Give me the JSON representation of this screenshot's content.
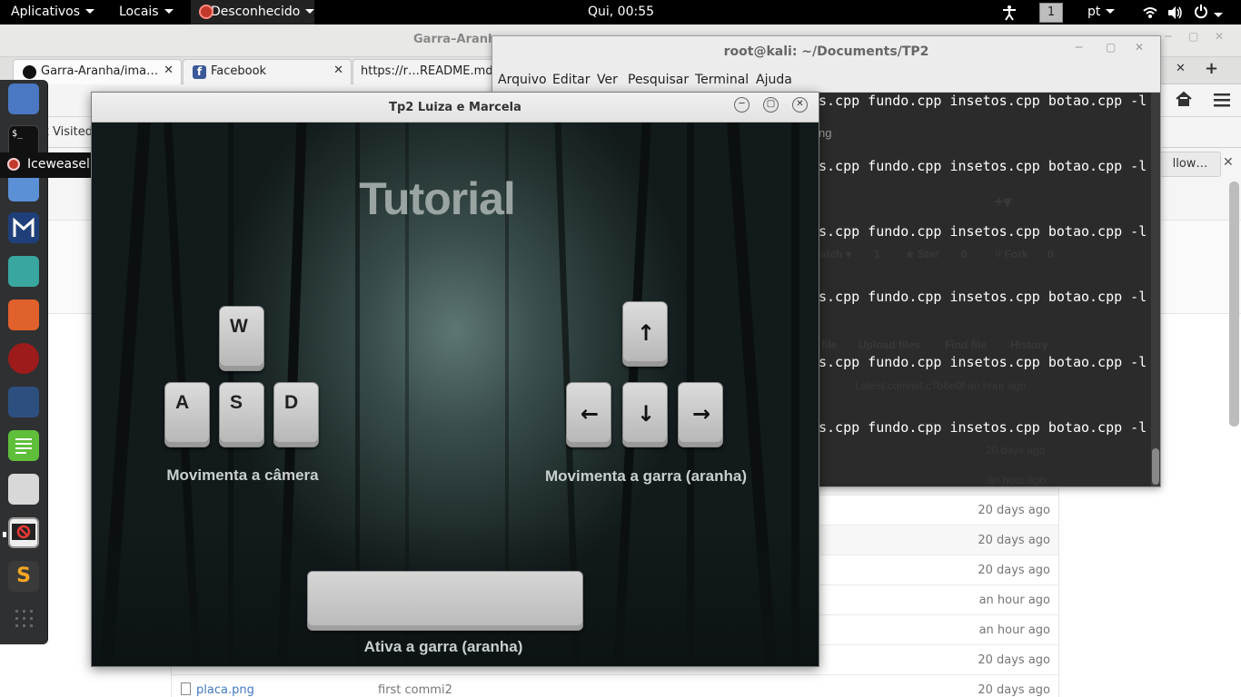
{
  "topbar": {
    "applications": "Aplicativos",
    "places": "Locais",
    "active_app": "Desconhecido",
    "clock": "Qui, 00:55",
    "workspace": "1",
    "language": "pt"
  },
  "browser": {
    "title": "Garra–Aranha",
    "tabs": [
      {
        "label": "Garra-Aranha/ima…"
      },
      {
        "label": "Facebook"
      },
      {
        "label": "https://r…README.md"
      }
    ],
    "bookmarks_text": "st Visited",
    "follow_label": "llow…",
    "repo": {
      "watch_label": "atch",
      "watch_count": "1",
      "star_label": "Star",
      "star_count": "0",
      "fork_label": "Fork",
      "fork_count": "0",
      "tabs_text": [
        "file",
        "Upload files",
        "Find file",
        "History"
      ],
      "latest_commit": "Latest commit c7b6e0f an hour ago"
    },
    "files": [
      {
        "age": "20 days ago"
      },
      {
        "age": "an hour ago"
      },
      {
        "age": "20 days ago"
      },
      {
        "age": "20 days ago"
      },
      {
        "age": "20 days ago"
      },
      {
        "age": "an hour ago"
      },
      {
        "age": "an hour ago"
      },
      {
        "age": "20 days ago"
      },
      {
        "name": "placa.png",
        "message": "first commi2",
        "age": "20 days ago"
      }
    ]
  },
  "terminal": {
    "title": "root@kali: ~/Documents/TP2",
    "menu": [
      "Arquivo",
      "Editar",
      "Ver",
      "Pesquisar",
      "Terminal",
      "Ajuda"
    ],
    "command_fragment": "s.cpp fundo.cpp insetos.cpp botao.cpp -l",
    "faint_fragment": "ng"
  },
  "dock": {
    "tooltip": "Iceweasel"
  },
  "game": {
    "title": "Tp2 Luiza e Marcela",
    "heading": "Tutorial",
    "keys_left": [
      "W",
      "A",
      "S",
      "D"
    ],
    "caption_left": "Movimenta a câmera",
    "arrows": {
      "up": "↑",
      "left": "←",
      "down": "↓",
      "right": "→"
    },
    "caption_right": "Movimenta a garra (aranha)",
    "caption_bottom": "Ativa a garra (aranha)"
  }
}
